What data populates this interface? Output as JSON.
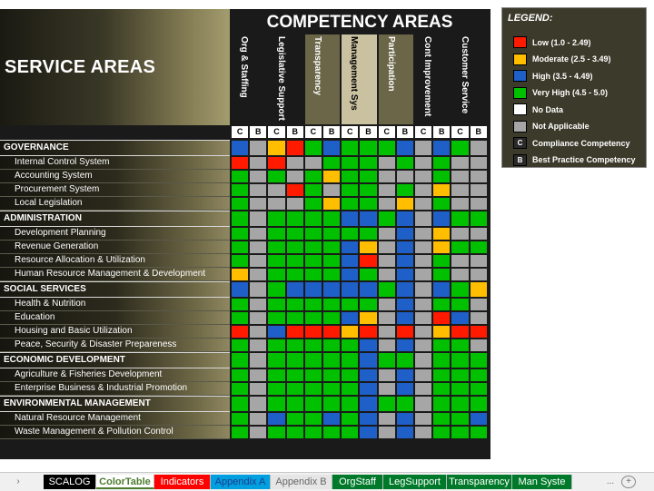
{
  "sheet": {
    "service_title": "SERVICE AREAS",
    "competency_title": "COMPETENCY AREAS",
    "competencies": [
      {
        "name": "Org & Staffing",
        "head_bg": "#1a1a1a",
        "head_fg": "#ffffff"
      },
      {
        "name": "Legislative Support",
        "head_bg": "#1a1a1a",
        "head_fg": "#ffffff"
      },
      {
        "name": "Transparency",
        "head_bg": "#6b6648",
        "head_fg": "#ffffff"
      },
      {
        "name": "Management Sys",
        "head_bg": "#c9c1a0",
        "head_fg": "#000000"
      },
      {
        "name": "Participation",
        "head_bg": "#6b6648",
        "head_fg": "#ffffff"
      },
      {
        "name": "Cont Improvement",
        "head_bg": "#1a1a1a",
        "head_fg": "#ffffff"
      },
      {
        "name": "Customer Service",
        "head_bg": "#1a1a1a",
        "head_fg": "#ffffff"
      }
    ],
    "sub_cols": [
      "C",
      "B"
    ],
    "colors": {
      "R": "#ff1a00",
      "Y": "#ffbf00",
      "B": "#1f5fc8",
      "G": "#00c000",
      "W": "#ffffff",
      "A": "#a6a6a6"
    },
    "rows": [
      {
        "label": "GOVERNANCE",
        "group": true,
        "cells": "BAYRGBGGGBABGA"
      },
      {
        "label": "Internal Control System",
        "group": false,
        "cells": "RARAAGGGAGAGAA"
      },
      {
        "label": "Accounting System",
        "group": false,
        "cells": "GAGAGYGGAAAGAA"
      },
      {
        "label": "Procurement System",
        "group": false,
        "cells": "GAARGAGGAGAYAA"
      },
      {
        "label": "Local Legislation",
        "group": false,
        "cells": "GAAAGYGGAYAGAA"
      },
      {
        "label": "ADMINISTRATION",
        "group": true,
        "cells": "GAGGGGBBGBABGG"
      },
      {
        "label": "Development Planning",
        "group": false,
        "cells": "GAGGGGGGABAYAA"
      },
      {
        "label": "Revenue Generation",
        "group": false,
        "cells": "GAGGGGBYABAYGG"
      },
      {
        "label": "Resource Allocation & Utilization",
        "group": false,
        "cells": "GAGGGGBRABAGAA"
      },
      {
        "label": "Human Resource Management & Development",
        "group": false,
        "cells": "YAGGGGBGABAGAA"
      },
      {
        "label": "SOCIAL SERVICES",
        "group": true,
        "cells": "BAGBBBBBGBABGY"
      },
      {
        "label": "Health & Nutrition",
        "group": false,
        "cells": "GAGGGGGGABAGGA"
      },
      {
        "label": "Education",
        "group": false,
        "cells": "GAGGGGBYABARBA"
      },
      {
        "label": "Housing and Basic Utilization",
        "group": false,
        "cells": "RABRRRYRARAYRR"
      },
      {
        "label": "Peace, Security & Disaster Prepareness",
        "group": false,
        "cells": "GAGGGGGBABAGGA"
      },
      {
        "label": "ECONOMIC DEVELOPMENT",
        "group": true,
        "cells": "GAGGGGGBGGAGGG"
      },
      {
        "label": "Agriculture & Fisheries Development",
        "group": false,
        "cells": "GAGGGGGBABAGGG"
      },
      {
        "label": "Enterprise Business & Industrial Promotion",
        "group": false,
        "cells": "GAGGGGGBABAGGG"
      },
      {
        "label": "ENVIRONMENTAL MANAGEMENT",
        "group": true,
        "cells": "GAGGGGGBGGAGGG"
      },
      {
        "label": "Natural Resource Management",
        "group": false,
        "cells": "GABGGBGBABAGGB"
      },
      {
        "label": "Waste Management & Pollution Control",
        "group": false,
        "cells": "GAGGGGGBABAGGG"
      }
    ]
  },
  "legend": {
    "title": "LEGEND:",
    "items": [
      {
        "color": "#ff1a00",
        "label": "Low (1.0 - 2.49)",
        "mark": ""
      },
      {
        "color": "#ffbf00",
        "label": "Moderate (2.5 - 3.49)",
        "mark": ""
      },
      {
        "color": "#1f5fc8",
        "label": "High (3.5 - 4.49)",
        "mark": ""
      },
      {
        "color": "#00c000",
        "label": "Very High (4.5 - 5.0)",
        "mark": ""
      },
      {
        "color": "#ffffff",
        "label": "No Data",
        "mark": ""
      },
      {
        "color": "#a6a6a6",
        "label": "Not Applicable",
        "mark": ""
      },
      {
        "color": "#2a2a2a",
        "label": "Compliance Competency",
        "mark": "C"
      },
      {
        "color": "#2a2a2a",
        "label": "Best Practice Competency",
        "mark": "B"
      }
    ]
  },
  "tabs": [
    {
      "label": "SCALOG",
      "bg": "#000000",
      "fg": "#ffffff"
    },
    {
      "label": "ColorTable",
      "bg": "#ffffff",
      "fg": "#4c7c2c"
    },
    {
      "label": "Indicators",
      "bg": "#ff0000",
      "fg": "#ffffff"
    },
    {
      "label": "Appendix A",
      "bg": "#00a0e0",
      "fg": "#1f3a8a"
    },
    {
      "label": "Appendix B",
      "bg": "#e6e6e6",
      "fg": "#666666"
    },
    {
      "label": "OrgStaff",
      "bg": "#007a2a",
      "fg": "#ffffff"
    },
    {
      "label": "LegSupport",
      "bg": "#007a2a",
      "fg": "#ffffff"
    },
    {
      "label": "Transparency",
      "bg": "#007a2a",
      "fg": "#ffffff"
    },
    {
      "label": "Man Syste",
      "bg": "#007a2a",
      "fg": "#ffffff"
    }
  ],
  "tab_nav": {
    "next": "›",
    "more": "...",
    "add": "+"
  }
}
